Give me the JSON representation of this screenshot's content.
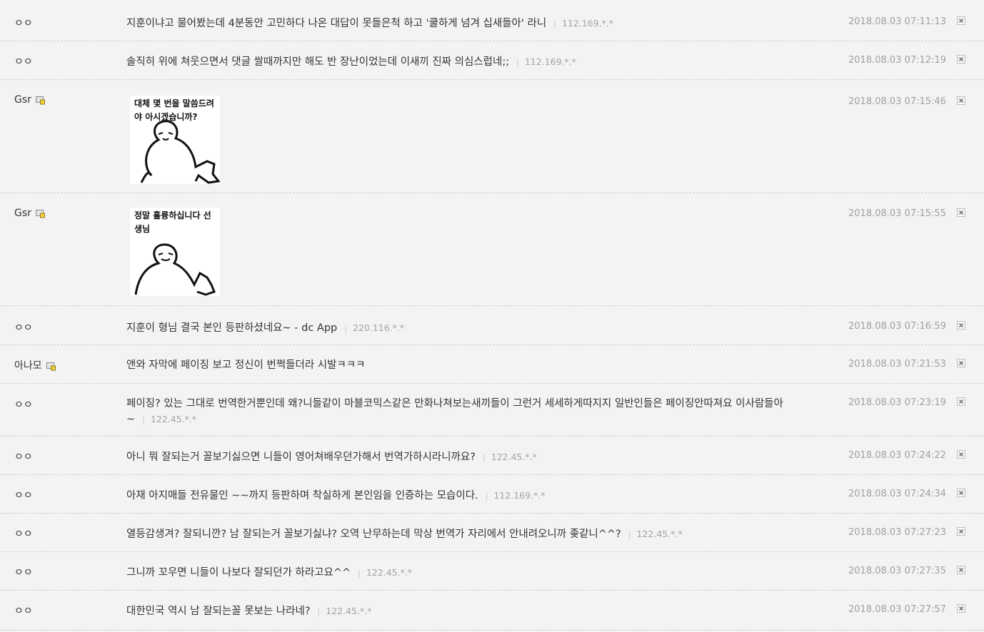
{
  "comments": [
    {
      "author": "ㅇㅇ",
      "text": "지훈이냐고 물어봤는데 4분동안 고민하다 나온 대답이 못들은척 하고 '쿨하게 넘겨 십새들아' 라니",
      "sep": "|",
      "ip": "112.169.*.*",
      "date": "2018.08.03 07:11:13"
    },
    {
      "author": "ㅇㅇ",
      "text": "솔직히 위에 쳐웃으면서 댓글 쌀때까지만 해도 반 장난이었는데 이새끼 진짜 의심스럽네;;",
      "sep": "|",
      "ip": "112.169.*.*",
      "date": "2018.08.03 07:12:19"
    },
    {
      "author": "Gsr",
      "sticker_text": "대체 몇 번을 말씀드려야 아시겠습니까?",
      "date": "2018.08.03 07:15:46"
    },
    {
      "author": "Gsr",
      "sticker_text": "정말 훌륭하십니다 선생님",
      "date": "2018.08.03 07:15:55"
    },
    {
      "author": "ㅇㅇ",
      "text": "지훈이 형님 결국 본인 등판하셨네요~ - dc App",
      "sep": "|",
      "ip": "220.116.*.*",
      "date": "2018.08.03 07:16:59"
    },
    {
      "author": "아나모",
      "text": "앤와 자막에 페이징 보고 정신이 번쩍들더라 시발ㅋㅋㅋ",
      "date": "2018.08.03 07:21:53"
    },
    {
      "author": "ㅇㅇ",
      "text": "페이징? 있는 그대로 번역한거뿐인데 왜?니들같이 마블코믹스같은 만화나쳐보는새끼들이 그런거 세세하게따지지 일반인들은 페이징안따져요 이사람들아~",
      "sep": "|",
      "ip": "122.45.*.*",
      "date": "2018.08.03 07:23:19"
    },
    {
      "author": "ㅇㅇ",
      "text": "아니 뭐 잘되는거 꼴보기싫으면 니들이 영어쳐배우던가해서 번역가하시라니까요?",
      "sep": "|",
      "ip": "122.45.*.*",
      "date": "2018.08.03 07:24:22"
    },
    {
      "author": "ㅇㅇ",
      "text": "아재 아지매들 전유물인 ~~까지 등판하며 착실하게 본인임을 인증하는 모습이다.",
      "sep": "|",
      "ip": "112.169.*.*",
      "date": "2018.08.03 07:24:34"
    },
    {
      "author": "ㅇㅇ",
      "text": "열등감생겨? 잘되니깐? 남 잘되는거 꼴보기싫냐? 오역 난무하는데 막상 번역가 자리에서 안내려오니까 좆같니^^?",
      "sep": "|",
      "ip": "122.45.*.*",
      "date": "2018.08.03 07:27:23"
    },
    {
      "author": "ㅇㅇ",
      "text": "그니까 꼬우면 니들이 나보다 잘되던가 하라고요^^",
      "sep": "|",
      "ip": "122.45.*.*",
      "date": "2018.08.03 07:27:35"
    },
    {
      "author": "ㅇㅇ",
      "text": "대한민국 역시 남 잘되는꼴 못보는 나라네?",
      "sep": "|",
      "ip": "122.45.*.*",
      "date": "2018.08.03 07:27:57"
    }
  ]
}
